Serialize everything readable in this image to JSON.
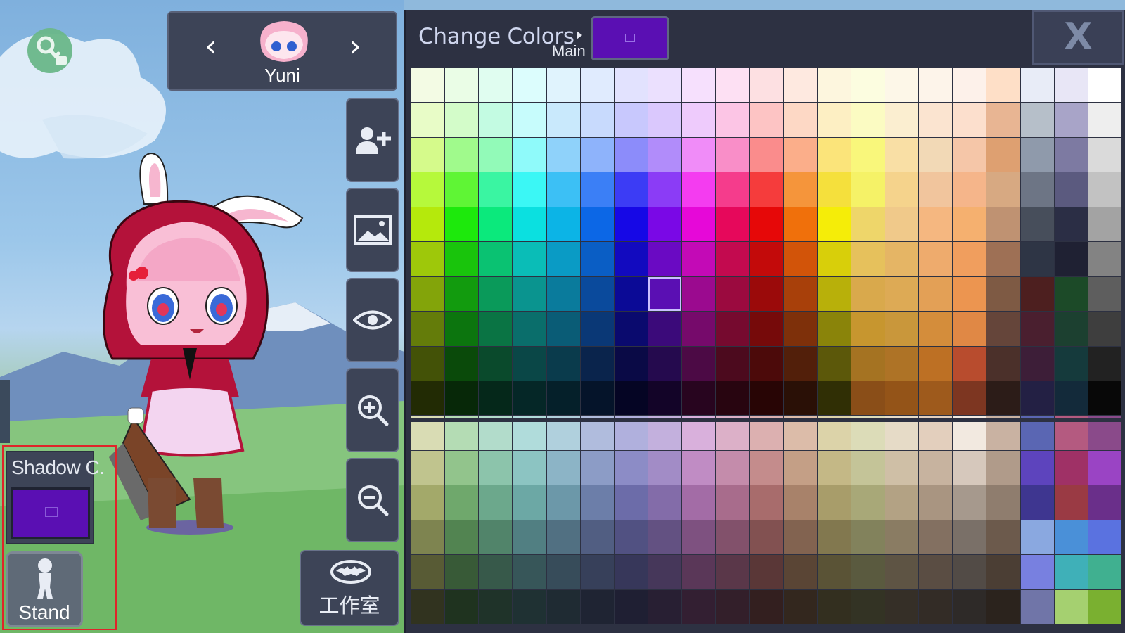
{
  "character": {
    "name": "Yuni"
  },
  "studio_button": {
    "label": "工作室"
  },
  "shadow_color": {
    "label": "Shadow C.",
    "color": "#5a0fb3"
  },
  "pose_button": {
    "label": "Stand"
  },
  "color_panel": {
    "title": "Change Colors",
    "target_label": "Main",
    "current_color": "#5a0fb3",
    "close_label": "X",
    "selected_cell": {
      "row": 6,
      "col": 7
    },
    "palette": [
      [
        "#f3fbe4",
        "#eafde6",
        "#e0fdf0",
        "#dcfdfd",
        "#e0f3fd",
        "#e0ebfe",
        "#e2e2fe",
        "#ebe0fe",
        "#f6e0fd",
        "#fde0f3",
        "#fde0e2",
        "#fee9e0",
        "#fdf6de",
        "#fcfde0",
        "#fdf7e8",
        "#fdf4ea",
        "#fdf1ea",
        "#fedfc7",
        "#e8ecf7",
        "#e8e6f6",
        "#ffffff"
      ],
      [
        "#e8fcc7",
        "#d3fcc9",
        "#c3fbe2",
        "#c7fcfc",
        "#c9e9fc",
        "#c8dafd",
        "#c8c8fd",
        "#dac8fd",
        "#eecbfc",
        "#fcc5e5",
        "#fdc4c4",
        "#fdd8c5",
        "#fdefc3",
        "#fbfbc2",
        "#fbeed0",
        "#fbe4d0",
        "#fcdfcd",
        "#e8b593",
        "#b6bfc9",
        "#a8a4c8",
        "#eeeeee"
      ],
      [
        "#d5fa8b",
        "#a0fa8c",
        "#92fab8",
        "#8ffafa",
        "#8fd2fa",
        "#8eb3fb",
        "#8c8cfa",
        "#b18cfa",
        "#f08cf8",
        "#f98ec8",
        "#fa8c8c",
        "#fbae8a",
        "#fbe47a",
        "#f9f77b",
        "#f9dfa5",
        "#f2d9b6",
        "#f5c6a8",
        "#dea071",
        "#8f9aab",
        "#7d7aa2",
        "#dadada"
      ],
      [
        "#b6f93b",
        "#5ff535",
        "#3af5a2",
        "#3bf7f5",
        "#3cc0f5",
        "#3b7ff6",
        "#3c3cf5",
        "#8b3cf6",
        "#f43cf0",
        "#f53c8c",
        "#f53c3c",
        "#f5953b",
        "#f5e03c",
        "#f5f267",
        "#f5d38c",
        "#f1c59d",
        "#f5b58a",
        "#d7a982",
        "#6d7585",
        "#5b5a7f",
        "#c2c2c2"
      ],
      [
        "#b5e90c",
        "#1de90c",
        "#0be97c",
        "#0be0e0",
        "#0cb4e6",
        "#0c67e6",
        "#1608e6",
        "#7a08e6",
        "#e608d8",
        "#e6085b",
        "#e60808",
        "#f0700b",
        "#f5ed08",
        "#eed66a",
        "#f0c98a",
        "#f5b780",
        "#f5b06f",
        "#bf9272",
        "#474e5b",
        "#2b2e45",
        "#a3a3a3"
      ],
      [
        "#9ec80a",
        "#19c40c",
        "#0ac272",
        "#0abdb7",
        "#0a9bc5",
        "#0a5ec5",
        "#120abf",
        "#6a0ac3",
        "#c30ab6",
        "#c30a4f",
        "#c30a0a",
        "#d25409",
        "#d8cf0a",
        "#e6c15c",
        "#e5b565",
        "#eeab6d",
        "#f09e5e",
        "#9e7055",
        "#2e3545",
        "#1f2133",
        "#838383"
      ],
      [
        "#83a40a",
        "#129b0e",
        "#0a9a5a",
        "#0a948f",
        "#0a7b9c",
        "#0a4a9c",
        "#0b0a96",
        "#5a0fb3",
        "#9b0a8f",
        "#9b0a3f",
        "#9b0a0a",
        "#a8400a",
        "#b8b00a",
        "#d9a94c",
        "#ddaa55",
        "#e3a056",
        "#ec9550",
        "#7e5a44",
        "#4d1f1f",
        "#1c4a28",
        "#5e5e5e"
      ],
      [
        "#647c0a",
        "#0c750e",
        "#0a7444",
        "#0a6e6b",
        "#0a5c76",
        "#0a3876",
        "#0a0a6e",
        "#3b0a7a",
        "#760a6b",
        "#760a2f",
        "#760a0a",
        "#7e300a",
        "#8a840a",
        "#c7962f",
        "#c9973b",
        "#d48d3b",
        "#e08845",
        "#65453a",
        "#4a1f2f",
        "#1c4030",
        "#3e3e3e"
      ],
      [
        "#435207",
        "#0a4a0a",
        "#0a4a2c",
        "#0a4747",
        "#0a3b4c",
        "#0a244c",
        "#0a0a46",
        "#250a4e",
        "#4c0a45",
        "#4c0a1e",
        "#4c0a0a",
        "#521f0a",
        "#5c580a",
        "#a57322",
        "#ae7326",
        "#bd7024",
        "#b84c2e",
        "#4b302a",
        "#3d1e38",
        "#153a3c",
        "#222222"
      ],
      [
        "#222b04",
        "#072808",
        "#05281a",
        "#052727",
        "#05202a",
        "#05142a",
        "#050524",
        "#130428",
        "#28051f",
        "#280510",
        "#280505",
        "#2a1006",
        "#302f05",
        "#8a4e18",
        "#945418",
        "#9e5a1c",
        "#7d3621",
        "#2c1c18",
        "#232044",
        "#132a3a",
        "#080808"
      ],
      [
        "#d9dcb4",
        "#b4dcb4",
        "#b2dccb",
        "#b0dcdb",
        "#b0d0dd",
        "#b0bcdd",
        "#b0b0dd",
        "#c3b0dd",
        "#d9b0dc",
        "#dcb0c8",
        "#dcb0b0",
        "#dcbca9",
        "#dcd3a9",
        "#dcdcb8",
        "#e6dbc7",
        "#e3cfbd",
        "#f2e9e0",
        "#c9b2a2",
        "#5a66b3",
        "#b45a80",
        "#8a4a8a"
      ],
      [
        "#c0c48e",
        "#92c48c",
        "#8cc4ab",
        "#8cc4c2",
        "#8cb4c6",
        "#8c9cc6",
        "#8c8cc6",
        "#a28cc6",
        "#c08cc4",
        "#c48cab",
        "#c48c8c",
        "#c49f86",
        "#c4b886",
        "#c4c498",
        "#cfbfa6",
        "#c7b39f",
        "#d6c8bc",
        "#b09b8a",
        "#5d44bd",
        "#9f3166",
        "#9a44c4"
      ],
      [
        "#a3a96a",
        "#6fa86c",
        "#6ca88c",
        "#6ca8a5",
        "#6c98a9",
        "#6c7ea9",
        "#6c6ca9",
        "#836ca9",
        "#a36ca6",
        "#a86c8c",
        "#a86c6c",
        "#a8826a",
        "#a89d6a",
        "#a8a878",
        "#b3a284",
        "#a99581",
        "#a6998d",
        "#8f7d6e",
        "#3e3690",
        "#9a3a44",
        "#6a2f8a"
      ],
      [
        "#7e8450",
        "#528451",
        "#51846a",
        "#517f82",
        "#517082",
        "#515e82",
        "#515182",
        "#635182",
        "#7e5180",
        "#82516b",
        "#825151",
        "#826350",
        "#82784f",
        "#82825c",
        "#8a7c63",
        "#837061",
        "#7a7068",
        "#6c5a4c",
        "#8aa8e0",
        "#4a90d8",
        "#5a72e0"
      ],
      [
        "#585b35",
        "#385a37",
        "#37594a",
        "#375659",
        "#374c5a",
        "#37405a",
        "#37375a",
        "#46375a",
        "#5a3758",
        "#5a3749",
        "#5a3737",
        "#5a4535",
        "#5a5336",
        "#5a5a3f",
        "#5e5444",
        "#5a4d43",
        "#524b46",
        "#4b3e34",
        "#7880e0",
        "#3fb0b8",
        "#40b090"
      ],
      [
        "#31331f",
        "#1f331f",
        "#1f3329",
        "#1f3133",
        "#1f2b33",
        "#1f2433",
        "#1f1f33",
        "#281f33",
        "#331f32",
        "#331f2a",
        "#331f1f",
        "#33271e",
        "#332f1f",
        "#333324",
        "#352f27",
        "#332c26",
        "#2e2a28",
        "#2b231d",
        "#7075a8",
        "#a5d070",
        "#7ab030"
      ]
    ]
  }
}
